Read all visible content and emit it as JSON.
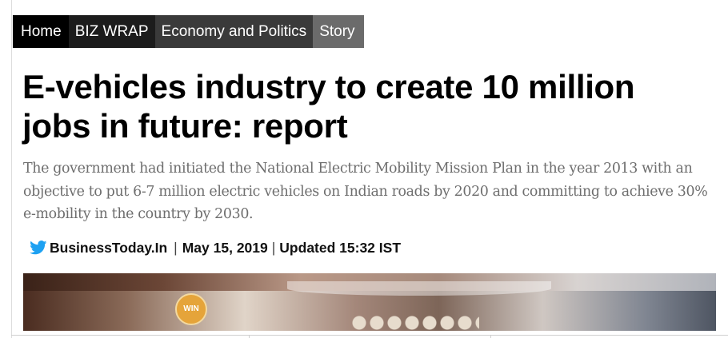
{
  "breadcrumb": {
    "items": [
      {
        "label": "Home"
      },
      {
        "label": "BIZ WRAP"
      },
      {
        "label": "Economy and Politics"
      },
      {
        "label": "Story"
      }
    ]
  },
  "article": {
    "headline": "E-vehicles industry to create 10 million jobs in future: report",
    "summary": "The government had initiated the National Electric Mobility Mission Plan in the year 2013 with an objective to put 6-7 million electric vehicles on Indian roads by 2020 and committing to achieve 30% e-mobility in the country by 2030.",
    "byline": {
      "author": "BusinessToday.In",
      "separator": "|",
      "date": "May 15, 2019",
      "updated": "Updated 15:32 IST",
      "author_icon": "twitter-bird-icon"
    },
    "hero_image": {
      "badge_text": "WIN"
    }
  },
  "colors": {
    "breadcrumb_home": "#000000",
    "breadcrumb_bizwrap": "#1c1c1c",
    "breadcrumb_economy": "#3a3a3a",
    "breadcrumb_story": "#6b6b6b",
    "summary_text": "#6e6e6e",
    "twitter_blue": "#1da1f2"
  }
}
